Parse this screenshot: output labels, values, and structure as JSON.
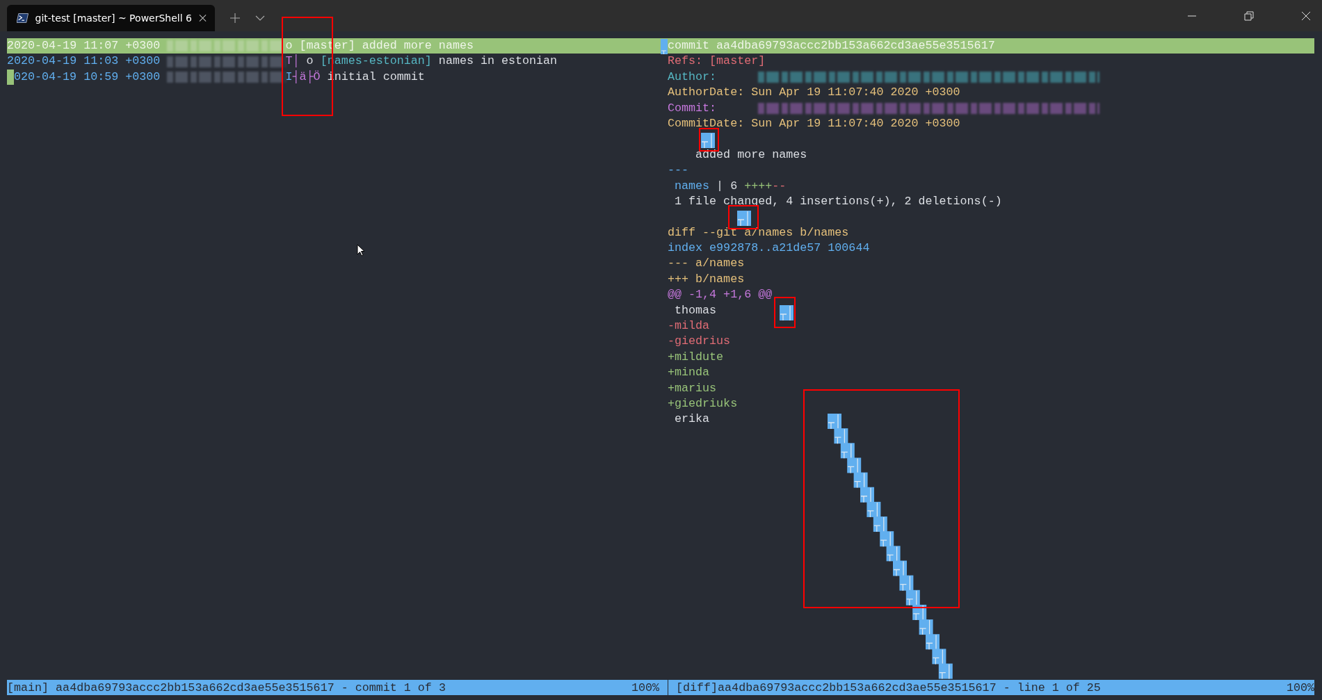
{
  "tab": {
    "title": "git-test [master] ~ PowerShell 6",
    "selected": true
  },
  "log": [
    {
      "selected": true,
      "segments": [
        {
          "kind": "date",
          "text": "2020-04-19 11:07 +0300"
        },
        {
          "kind": "redacted"
        },
        {
          "kind": "graph",
          "text": "o "
        },
        {
          "kind": "ref",
          "text": "[master]"
        },
        {
          "kind": "text",
          "text": " added more names"
        }
      ]
    },
    {
      "selected": false,
      "segments": [
        {
          "kind": "date",
          "text": "2020-04-19 11:03 +0300"
        },
        {
          "kind": "redacted"
        },
        {
          "kind": "graph",
          "text": "T│"
        },
        {
          "kind": "text",
          "text": " o "
        },
        {
          "kind": "ref",
          "text": "[names-estonian]"
        },
        {
          "kind": "text",
          "text": " names in estonian"
        }
      ]
    },
    {
      "selected": false,
      "segments": [
        {
          "kind": "cursor"
        },
        {
          "kind": "date",
          "text": "020-04-19 10:59 +0300"
        },
        {
          "kind": "redacted"
        },
        {
          "kind": "date",
          "text": "I"
        },
        {
          "kind": "graph",
          "text": "┤ä├Ö"
        },
        {
          "kind": "text",
          "text": " initial commit"
        }
      ]
    }
  ],
  "diff": [
    {
      "kind": "text",
      "selected": true,
      "segments": [
        {
          "kind": "hash",
          "text": "commit aa4dba69793accc2bb153a662cd3ae55e3515617"
        }
      ]
    },
    {
      "kind": "text",
      "selected": false,
      "segments": [
        {
          "kind": "refs",
          "text": "Refs: [master]"
        }
      ]
    },
    {
      "kind": "text",
      "selected": false,
      "segments": [
        {
          "kind": "author",
          "text": "Author:     "
        },
        {
          "kind": "redacted-author"
        }
      ]
    },
    {
      "kind": "text",
      "selected": false,
      "segments": [
        {
          "kind": "header",
          "text": "AuthorDate: Sun Apr 19 11:07:40 2020 +0300"
        }
      ]
    },
    {
      "kind": "text",
      "selected": false,
      "segments": [
        {
          "kind": "committer",
          "text": "Commit:     "
        },
        {
          "kind": "redacted-committer"
        }
      ]
    },
    {
      "kind": "text",
      "selected": false,
      "segments": [
        {
          "kind": "header",
          "text": "CommitDate: Sun Apr 19 11:07:40 2020 +0300"
        }
      ]
    },
    {
      "kind": "blank",
      "selected": false
    },
    {
      "kind": "text",
      "selected": false,
      "segments": [
        {
          "kind": "plain",
          "text": "    added more names"
        }
      ]
    },
    {
      "kind": "text",
      "selected": false,
      "segments": [
        {
          "kind": "index",
          "text": "---"
        }
      ]
    },
    {
      "kind": "text",
      "selected": false,
      "segments": [
        {
          "kind": "index",
          "text": " names"
        },
        {
          "kind": "plain",
          "text": " | 6 "
        },
        {
          "kind": "add",
          "text": "++++"
        },
        {
          "kind": "del",
          "text": "--"
        }
      ]
    },
    {
      "kind": "text",
      "selected": false,
      "segments": [
        {
          "kind": "plain",
          "text": " 1 file changed, 4 insertions(+), 2 deletions(-)"
        }
      ]
    },
    {
      "kind": "blank",
      "selected": false
    },
    {
      "kind": "text",
      "selected": false,
      "segments": [
        {
          "kind": "header",
          "text": "diff --git a/names b/names"
        }
      ]
    },
    {
      "kind": "text",
      "selected": false,
      "segments": [
        {
          "kind": "index",
          "text": "index e992878..a21de57 100644"
        }
      ]
    },
    {
      "kind": "text",
      "selected": false,
      "segments": [
        {
          "kind": "header",
          "text": "--- a/names"
        }
      ]
    },
    {
      "kind": "text",
      "selected": false,
      "segments": [
        {
          "kind": "header",
          "text": "+++ b/names"
        }
      ]
    },
    {
      "kind": "text",
      "selected": false,
      "segments": [
        {
          "kind": "hunk",
          "text": "@@ -1,4 +1,6 @@"
        }
      ]
    },
    {
      "kind": "text",
      "selected": false,
      "segments": [
        {
          "kind": "plain",
          "text": " thomas"
        }
      ]
    },
    {
      "kind": "text",
      "selected": false,
      "segments": [
        {
          "kind": "del",
          "text": "-milda"
        }
      ]
    },
    {
      "kind": "text",
      "selected": false,
      "segments": [
        {
          "kind": "del",
          "text": "-giedrius"
        }
      ]
    },
    {
      "kind": "text",
      "selected": false,
      "segments": [
        {
          "kind": "add",
          "text": "+mildute"
        }
      ]
    },
    {
      "kind": "text",
      "selected": false,
      "segments": [
        {
          "kind": "add",
          "text": "+minda"
        }
      ]
    },
    {
      "kind": "text",
      "selected": false,
      "segments": [
        {
          "kind": "add",
          "text": "+marius"
        }
      ]
    },
    {
      "kind": "text",
      "selected": false,
      "segments": [
        {
          "kind": "add",
          "text": "+giedriuks"
        }
      ]
    },
    {
      "kind": "text",
      "selected": false,
      "segments": [
        {
          "kind": "plain",
          "text": " erika"
        }
      ]
    }
  ],
  "status": {
    "left": "[main] aa4dba69793accc2bb153a662cd3ae55e3515617 - commit 1 of 3",
    "left_percent": "100%",
    "right": "[diff]aa4dba69793accc2bb153a662cd3ae55e3515617 - line 1 of 25",
    "right_percent": "100%"
  }
}
